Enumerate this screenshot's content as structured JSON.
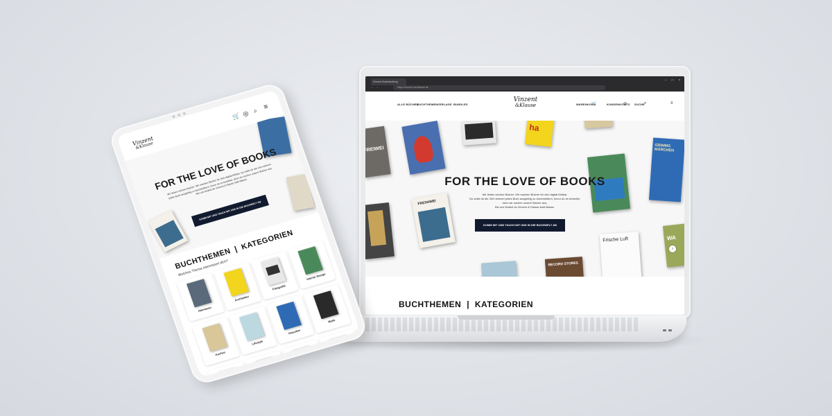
{
  "laptop": {
    "browser": {
      "tab_title": "Vinzenz Buchhandlung",
      "url": "https://vinzent-und-klause.de"
    },
    "nav": {
      "items": [
        "ALLE BÜCHER",
        "BUCHTHEMEN",
        "VERLAGE",
        "BUNDLES"
      ],
      "right_items": [
        "WARENKORB",
        "KUNDENKONTO",
        "SUCHE"
      ],
      "logo_line1": "Vinzent",
      "logo_line2": "&Klause"
    },
    "hero": {
      "title": "FOR THE LOVE OF BOOKS",
      "text_lines": [
        "Wir lieben schöne Bücher. Wir machen Bücher für dich digital fühlbar.",
        "Du sollst dir die Zeit nehmen jedes Buch ausgiebig zu durchstöbern, bevor du es bestellst,",
        "denn wir suchen unsere Bücher aus.",
        "Bei uns findest du Vinzent & Klause statt Masse."
      ],
      "cta": "KOMM MIT UND TAUCH MIT UNS IN DIE BUCHWELT AB",
      "book_titles": [
        "FREIWEI",
        "FRESHWEI",
        "GRIMMS MÄRCHEN",
        "Frische Luft",
        "RECORD STORES",
        "WA"
      ]
    },
    "section": {
      "left": "BUCHTHEMEN",
      "right": "KATEGORIEN"
    }
  },
  "tablet": {
    "logo_line1": "Vinzent",
    "logo_line2": "&Klause",
    "hero_title": "FOR THE LOVE OF BOOKS",
    "hero_text": "Wir lieben schöne Bücher. Wir machen Bücher für dich digital fühlbar. Du sollst dir die Zeit nehmen jedes Buch ausgiebig zu durchstöbern, bevor du es bestellst, denn wir suchen unsere Bücher aus. Bei uns findest du Vinzent & Klause statt Masse.",
    "cta": "KOMM MIT UND TAUCH MIT UNS IN DIE BUCHWELT AB",
    "section_left": "BUCHTHEMEN",
    "section_right": "KATEGORIEN",
    "section_sub": "Welches Thema interessiert dich?",
    "categories": [
      "Abenteuer",
      "Architektur",
      "Fotografie",
      "Interior Design",
      "Kochen",
      "Lifestyle",
      "Klassiker",
      "Mode"
    ]
  },
  "colors": {
    "cta_bg": "#111a2e",
    "background": "#dfe2e7"
  }
}
